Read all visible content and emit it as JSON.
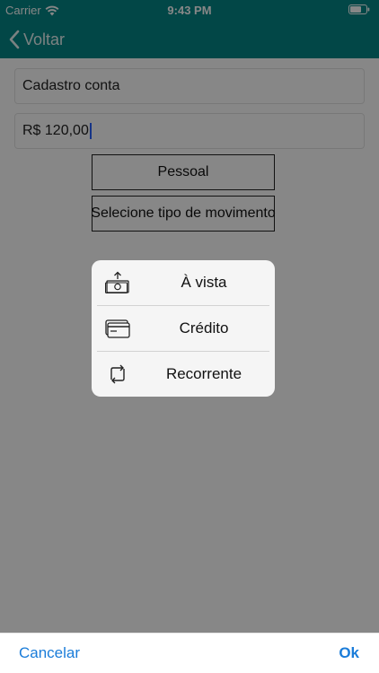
{
  "status_bar": {
    "carrier": "Carrier",
    "time": "9:43 PM"
  },
  "nav": {
    "back_label": "Voltar"
  },
  "form": {
    "name_value": "Cadastro conta",
    "amount_value": "R$ 120,00",
    "category_button": "Pessoal",
    "movement_button": "Selecione tipo de movimento"
  },
  "sheet": {
    "options": [
      {
        "label": "À vista",
        "icon": "cash-icon"
      },
      {
        "label": "Crédito",
        "icon": "credit-card-icon"
      },
      {
        "label": "Recorrente",
        "icon": "recurring-icon"
      }
    ]
  },
  "toolbar": {
    "cancel_label": "Cancelar",
    "ok_label": "Ok"
  },
  "colors": {
    "accent": "#058686",
    "link": "#1a7cd9"
  }
}
